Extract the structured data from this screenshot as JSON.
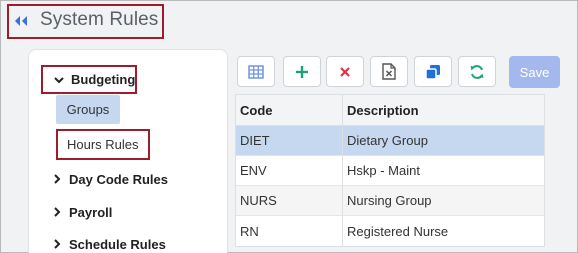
{
  "header": {
    "title": "System Rules",
    "back_icon": "double-chevron-left-icon"
  },
  "sidebar": {
    "section": {
      "label": "Budgeting",
      "icon": "chevron-down-icon"
    },
    "sub_items": [
      {
        "label": "Groups",
        "active": true
      },
      {
        "label": "Hours Rules",
        "active": false
      }
    ],
    "items": [
      {
        "label": "Day Code Rules",
        "icon": "chevron-right-icon"
      },
      {
        "label": "Payroll",
        "icon": "chevron-right-icon"
      },
      {
        "label": "Schedule Rules",
        "icon": "chevron-right-icon"
      }
    ]
  },
  "toolbar": {
    "buttons": [
      {
        "name": "grid-view-button",
        "icon": "grid-icon",
        "color": "#6a8fe0"
      },
      {
        "name": "add-button",
        "icon": "plus-icon",
        "color": "#1aa37a"
      },
      {
        "name": "delete-button",
        "icon": "x-icon",
        "color": "#e0344a"
      },
      {
        "name": "export-excel-button",
        "icon": "excel-file-icon",
        "color": "#555555"
      },
      {
        "name": "copy-button",
        "icon": "copy-icon",
        "color": "#1e6fe0"
      },
      {
        "name": "refresh-button",
        "icon": "refresh-icon",
        "color": "#1aa37a"
      }
    ],
    "save_label": "Save"
  },
  "table": {
    "columns": [
      "Code",
      "Description"
    ],
    "rows": [
      {
        "code": "DIET",
        "description": "Dietary Group",
        "selected": true
      },
      {
        "code": "ENV",
        "description": "Hskp - Maint",
        "selected": false
      },
      {
        "code": "NURS",
        "description": "Nursing Group",
        "selected": false
      },
      {
        "code": "RN",
        "description": "Registered Nurse",
        "selected": false
      }
    ]
  },
  "colors": {
    "highlight_border": "#9e1c2b",
    "selection": "#c5d8ef",
    "save_button": "#a4b8ee"
  }
}
